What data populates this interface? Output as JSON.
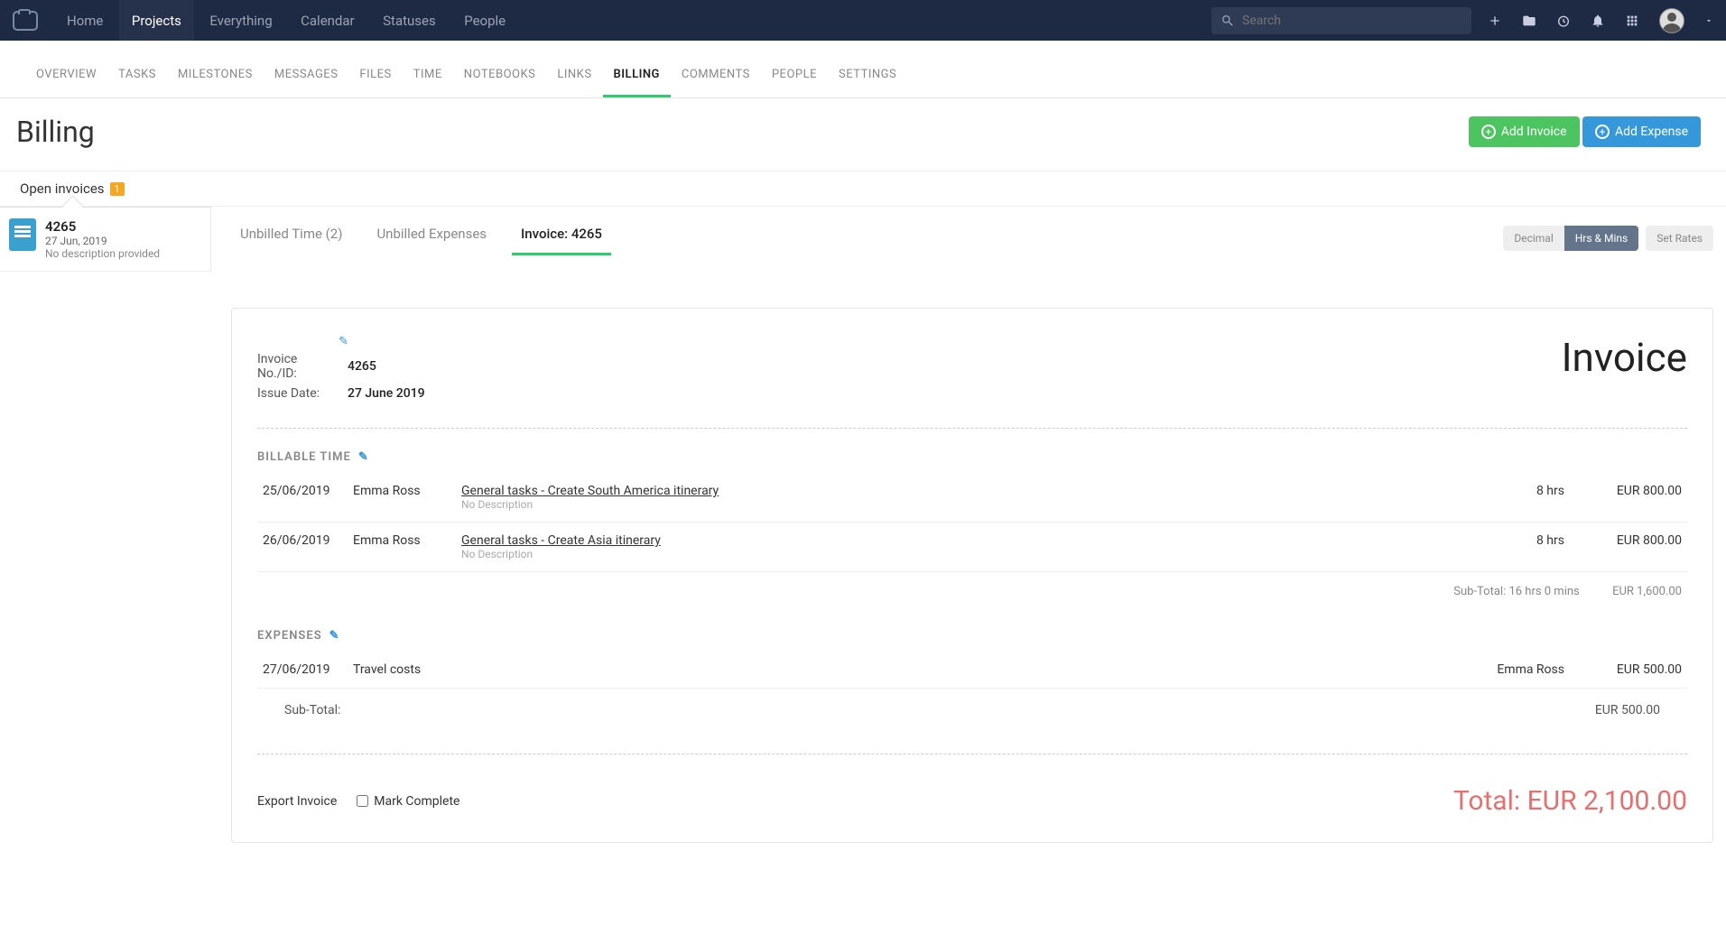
{
  "topnav": {
    "items": [
      "Home",
      "Projects",
      "Everything",
      "Calendar",
      "Statuses",
      "People"
    ],
    "active": "Projects",
    "search_placeholder": "Search"
  },
  "subnav": {
    "items": [
      "OVERVIEW",
      "TASKS",
      "MILESTONES",
      "MESSAGES",
      "FILES",
      "TIME",
      "NOTEBOOKS",
      "LINKS",
      "BILLING",
      "COMMENTS",
      "PEOPLE",
      "SETTINGS"
    ],
    "active": "BILLING"
  },
  "page_title": "Billing",
  "buttons": {
    "add_invoice": "Add Invoice",
    "add_expense": "Add Expense"
  },
  "open_invoices_label": "Open invoices",
  "open_invoices_count": "1",
  "left_invoice": {
    "id": "4265",
    "date": "27 Jun, 2019",
    "desc": "No description provided"
  },
  "tabs": {
    "t1": "Unbilled Time (2)",
    "t2": "Unbilled Expenses",
    "t3": "Invoice: 4265",
    "decimal": "Decimal",
    "hrsmins": "Hrs & Mins",
    "setrates": "Set Rates"
  },
  "invoice": {
    "id_label": "Invoice No./ID:",
    "id_value": "4265",
    "date_label": "Issue Date:",
    "date_value": "27 June 2019",
    "heading": "Invoice"
  },
  "billable_heading": "BILLABLE TIME",
  "billable": [
    {
      "date": "25/06/2019",
      "person": "Emma Ross",
      "task": "General tasks - Create South America itinerary",
      "desc": "No Description",
      "hrs": "8 hrs",
      "amount": "EUR 800.00"
    },
    {
      "date": "26/06/2019",
      "person": "Emma Ross",
      "task": "General tasks - Create Asia itinerary",
      "desc": "No Description",
      "hrs": "8 hrs",
      "amount": "EUR 800.00"
    }
  ],
  "billable_subtotal_label": "Sub-Total: 16 hrs 0 mins",
  "billable_subtotal_amount": "EUR 1,600.00",
  "expenses_heading": "EXPENSES",
  "expenses": [
    {
      "date": "27/06/2019",
      "desc": "Travel costs",
      "person": "Emma Ross",
      "amount": "EUR 500.00"
    }
  ],
  "expenses_subtotal_label": "Sub-Total:",
  "expenses_subtotal_amount": "EUR 500.00",
  "export_label": "Export Invoice",
  "mark_complete_label": "Mark Complete",
  "total_label": "Total: EUR 2,100.00"
}
